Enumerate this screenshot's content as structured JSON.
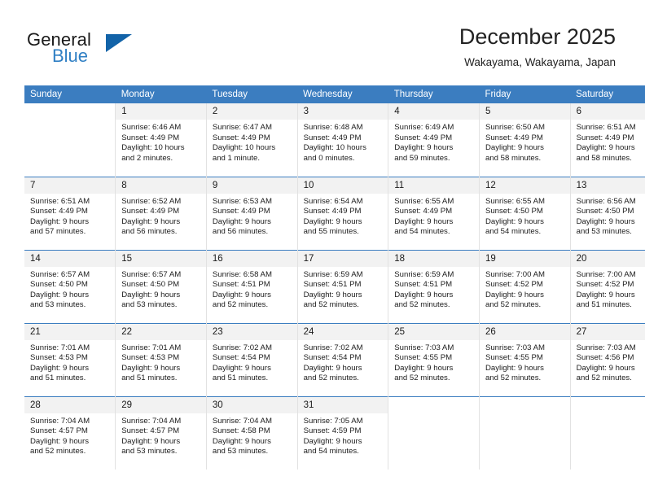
{
  "brand": {
    "name_part1": "General",
    "name_part2": "Blue",
    "accent_color": "#2f7fc4",
    "triangle_color": "#1263a8",
    "triangle_icon": "logo-triangle-icon"
  },
  "header": {
    "month_title": "December 2025",
    "location": "Wakayama, Wakayama, Japan"
  },
  "theme": {
    "header_row_bg": "#3b7dc0",
    "daynum_bg": "#f2f2f2",
    "cell_border": "#e2e2e2",
    "week_separator": "#3b7dc0"
  },
  "weekdays": [
    "Sunday",
    "Monday",
    "Tuesday",
    "Wednesday",
    "Thursday",
    "Friday",
    "Saturday"
  ],
  "weeks": [
    [
      {
        "day": "",
        "sunrise": "",
        "sunset": "",
        "daylight_line1": "",
        "daylight_line2": "",
        "empty": true
      },
      {
        "day": "1",
        "sunrise": "Sunrise: 6:46 AM",
        "sunset": "Sunset: 4:49 PM",
        "daylight_line1": "Daylight: 10 hours",
        "daylight_line2": "and 2 minutes.",
        "empty": false
      },
      {
        "day": "2",
        "sunrise": "Sunrise: 6:47 AM",
        "sunset": "Sunset: 4:49 PM",
        "daylight_line1": "Daylight: 10 hours",
        "daylight_line2": "and 1 minute.",
        "empty": false
      },
      {
        "day": "3",
        "sunrise": "Sunrise: 6:48 AM",
        "sunset": "Sunset: 4:49 PM",
        "daylight_line1": "Daylight: 10 hours",
        "daylight_line2": "and 0 minutes.",
        "empty": false
      },
      {
        "day": "4",
        "sunrise": "Sunrise: 6:49 AM",
        "sunset": "Sunset: 4:49 PM",
        "daylight_line1": "Daylight: 9 hours",
        "daylight_line2": "and 59 minutes.",
        "empty": false
      },
      {
        "day": "5",
        "sunrise": "Sunrise: 6:50 AM",
        "sunset": "Sunset: 4:49 PM",
        "daylight_line1": "Daylight: 9 hours",
        "daylight_line2": "and 58 minutes.",
        "empty": false
      },
      {
        "day": "6",
        "sunrise": "Sunrise: 6:51 AM",
        "sunset": "Sunset: 4:49 PM",
        "daylight_line1": "Daylight: 9 hours",
        "daylight_line2": "and 58 minutes.",
        "empty": false
      }
    ],
    [
      {
        "day": "7",
        "sunrise": "Sunrise: 6:51 AM",
        "sunset": "Sunset: 4:49 PM",
        "daylight_line1": "Daylight: 9 hours",
        "daylight_line2": "and 57 minutes.",
        "empty": false
      },
      {
        "day": "8",
        "sunrise": "Sunrise: 6:52 AM",
        "sunset": "Sunset: 4:49 PM",
        "daylight_line1": "Daylight: 9 hours",
        "daylight_line2": "and 56 minutes.",
        "empty": false
      },
      {
        "day": "9",
        "sunrise": "Sunrise: 6:53 AM",
        "sunset": "Sunset: 4:49 PM",
        "daylight_line1": "Daylight: 9 hours",
        "daylight_line2": "and 56 minutes.",
        "empty": false
      },
      {
        "day": "10",
        "sunrise": "Sunrise: 6:54 AM",
        "sunset": "Sunset: 4:49 PM",
        "daylight_line1": "Daylight: 9 hours",
        "daylight_line2": "and 55 minutes.",
        "empty": false
      },
      {
        "day": "11",
        "sunrise": "Sunrise: 6:55 AM",
        "sunset": "Sunset: 4:49 PM",
        "daylight_line1": "Daylight: 9 hours",
        "daylight_line2": "and 54 minutes.",
        "empty": false
      },
      {
        "day": "12",
        "sunrise": "Sunrise: 6:55 AM",
        "sunset": "Sunset: 4:50 PM",
        "daylight_line1": "Daylight: 9 hours",
        "daylight_line2": "and 54 minutes.",
        "empty": false
      },
      {
        "day": "13",
        "sunrise": "Sunrise: 6:56 AM",
        "sunset": "Sunset: 4:50 PM",
        "daylight_line1": "Daylight: 9 hours",
        "daylight_line2": "and 53 minutes.",
        "empty": false
      }
    ],
    [
      {
        "day": "14",
        "sunrise": "Sunrise: 6:57 AM",
        "sunset": "Sunset: 4:50 PM",
        "daylight_line1": "Daylight: 9 hours",
        "daylight_line2": "and 53 minutes.",
        "empty": false
      },
      {
        "day": "15",
        "sunrise": "Sunrise: 6:57 AM",
        "sunset": "Sunset: 4:50 PM",
        "daylight_line1": "Daylight: 9 hours",
        "daylight_line2": "and 53 minutes.",
        "empty": false
      },
      {
        "day": "16",
        "sunrise": "Sunrise: 6:58 AM",
        "sunset": "Sunset: 4:51 PM",
        "daylight_line1": "Daylight: 9 hours",
        "daylight_line2": "and 52 minutes.",
        "empty": false
      },
      {
        "day": "17",
        "sunrise": "Sunrise: 6:59 AM",
        "sunset": "Sunset: 4:51 PM",
        "daylight_line1": "Daylight: 9 hours",
        "daylight_line2": "and 52 minutes.",
        "empty": false
      },
      {
        "day": "18",
        "sunrise": "Sunrise: 6:59 AM",
        "sunset": "Sunset: 4:51 PM",
        "daylight_line1": "Daylight: 9 hours",
        "daylight_line2": "and 52 minutes.",
        "empty": false
      },
      {
        "day": "19",
        "sunrise": "Sunrise: 7:00 AM",
        "sunset": "Sunset: 4:52 PM",
        "daylight_line1": "Daylight: 9 hours",
        "daylight_line2": "and 52 minutes.",
        "empty": false
      },
      {
        "day": "20",
        "sunrise": "Sunrise: 7:00 AM",
        "sunset": "Sunset: 4:52 PM",
        "daylight_line1": "Daylight: 9 hours",
        "daylight_line2": "and 51 minutes.",
        "empty": false
      }
    ],
    [
      {
        "day": "21",
        "sunrise": "Sunrise: 7:01 AM",
        "sunset": "Sunset: 4:53 PM",
        "daylight_line1": "Daylight: 9 hours",
        "daylight_line2": "and 51 minutes.",
        "empty": false
      },
      {
        "day": "22",
        "sunrise": "Sunrise: 7:01 AM",
        "sunset": "Sunset: 4:53 PM",
        "daylight_line1": "Daylight: 9 hours",
        "daylight_line2": "and 51 minutes.",
        "empty": false
      },
      {
        "day": "23",
        "sunrise": "Sunrise: 7:02 AM",
        "sunset": "Sunset: 4:54 PM",
        "daylight_line1": "Daylight: 9 hours",
        "daylight_line2": "and 51 minutes.",
        "empty": false
      },
      {
        "day": "24",
        "sunrise": "Sunrise: 7:02 AM",
        "sunset": "Sunset: 4:54 PM",
        "daylight_line1": "Daylight: 9 hours",
        "daylight_line2": "and 52 minutes.",
        "empty": false
      },
      {
        "day": "25",
        "sunrise": "Sunrise: 7:03 AM",
        "sunset": "Sunset: 4:55 PM",
        "daylight_line1": "Daylight: 9 hours",
        "daylight_line2": "and 52 minutes.",
        "empty": false
      },
      {
        "day": "26",
        "sunrise": "Sunrise: 7:03 AM",
        "sunset": "Sunset: 4:55 PM",
        "daylight_line1": "Daylight: 9 hours",
        "daylight_line2": "and 52 minutes.",
        "empty": false
      },
      {
        "day": "27",
        "sunrise": "Sunrise: 7:03 AM",
        "sunset": "Sunset: 4:56 PM",
        "daylight_line1": "Daylight: 9 hours",
        "daylight_line2": "and 52 minutes.",
        "empty": false
      }
    ],
    [
      {
        "day": "28",
        "sunrise": "Sunrise: 7:04 AM",
        "sunset": "Sunset: 4:57 PM",
        "daylight_line1": "Daylight: 9 hours",
        "daylight_line2": "and 52 minutes.",
        "empty": false
      },
      {
        "day": "29",
        "sunrise": "Sunrise: 7:04 AM",
        "sunset": "Sunset: 4:57 PM",
        "daylight_line1": "Daylight: 9 hours",
        "daylight_line2": "and 53 minutes.",
        "empty": false
      },
      {
        "day": "30",
        "sunrise": "Sunrise: 7:04 AM",
        "sunset": "Sunset: 4:58 PM",
        "daylight_line1": "Daylight: 9 hours",
        "daylight_line2": "and 53 minutes.",
        "empty": false
      },
      {
        "day": "31",
        "sunrise": "Sunrise: 7:05 AM",
        "sunset": "Sunset: 4:59 PM",
        "daylight_line1": "Daylight: 9 hours",
        "daylight_line2": "and 54 minutes.",
        "empty": false
      },
      {
        "day": "",
        "sunrise": "",
        "sunset": "",
        "daylight_line1": "",
        "daylight_line2": "",
        "empty": true
      },
      {
        "day": "",
        "sunrise": "",
        "sunset": "",
        "daylight_line1": "",
        "daylight_line2": "",
        "empty": true
      },
      {
        "day": "",
        "sunrise": "",
        "sunset": "",
        "daylight_line1": "",
        "daylight_line2": "",
        "empty": true
      }
    ]
  ]
}
